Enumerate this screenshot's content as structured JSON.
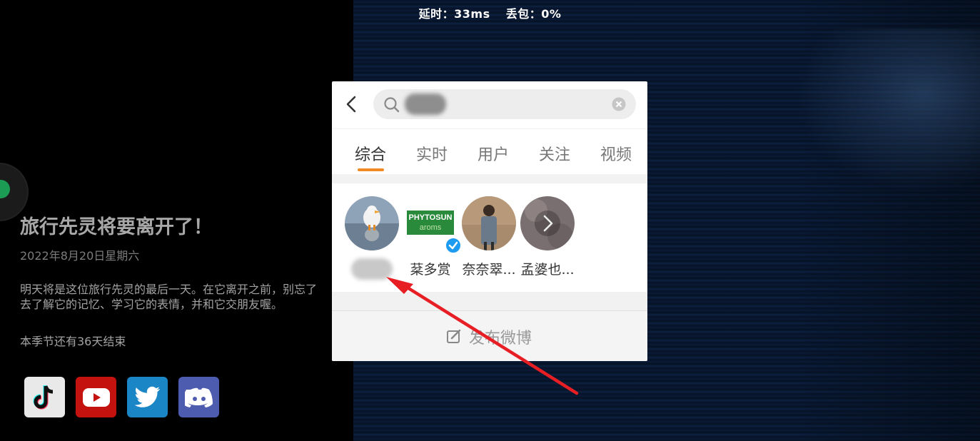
{
  "netstat": {
    "latency": "延时：33ms",
    "packet_loss": "丢包：0%"
  },
  "event": {
    "title": "旅行先灵将要离开了！",
    "date": "2022年8月20日星期六",
    "description": "明天将是这位旅行先灵的最后一天。在它离开之前，别忘了去了解它的记忆、学习它的表情，并和它交朋友喔。",
    "season_remaining": "本季节还有36天结束"
  },
  "socials": [
    {
      "name": "tiktok-icon"
    },
    {
      "name": "youtube-icon"
    },
    {
      "name": "twitter-icon"
    },
    {
      "name": "discord-icon"
    }
  ],
  "search_panel": {
    "tabs": [
      {
        "label": "综合",
        "active": true
      },
      {
        "label": "实时",
        "active": false
      },
      {
        "label": "用户",
        "active": false
      },
      {
        "label": "关注",
        "active": false
      },
      {
        "label": "视频",
        "active": false
      }
    ],
    "users": [
      {
        "name": "",
        "avatar": "duck-photo"
      },
      {
        "name": "棻多赏",
        "avatar_text_top": "PHYTOSUN",
        "avatar_text_bottom": "aroms",
        "verified": true
      },
      {
        "name": "奈奈翠...",
        "avatar": "person-photo"
      },
      {
        "name": "孟婆也...",
        "avatar": "more-arrow"
      }
    ],
    "post_label": "发布微博"
  },
  "colors": {
    "accent": "#f08a24",
    "brand_green": "#1c9b55",
    "arrow_red": "#e81e25",
    "verified_blue": "#1d9bf0"
  }
}
